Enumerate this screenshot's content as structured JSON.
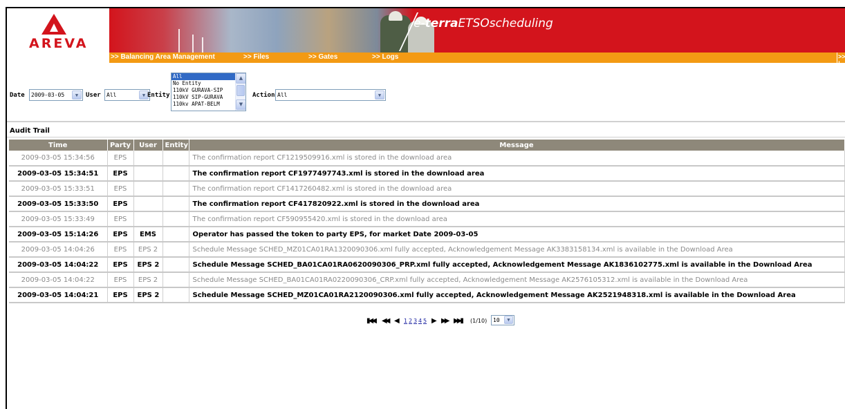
{
  "header": {
    "logo_text": "AREVA",
    "product_prefix": "e-",
    "product_bold": "terra",
    "product_rest": "ETSOscheduling"
  },
  "nav": {
    "items": [
      {
        "label": ">> Balancing Area Management"
      },
      {
        "label": ">> Files"
      },
      {
        "label": ">> Gates"
      },
      {
        "label": ">> Logs"
      }
    ],
    "overflow_label": ">> !"
  },
  "filters": {
    "date_label": "Date",
    "date_value": "2009-03-05",
    "user_label": "User",
    "user_value": "All",
    "entity_label": "Entity",
    "entity_options": [
      "All",
      "No Entity",
      "110kV GURAVA-SIP",
      "110kV SIP-GURAVA",
      "110kv APAT-BELM"
    ],
    "entity_selected": "All",
    "action_label": "Action",
    "action_value": "All"
  },
  "audit": {
    "title": "Audit Trail",
    "columns": [
      "Time",
      "Party",
      "User",
      "Entity",
      "Message"
    ],
    "rows": [
      {
        "time": "2009-03-05 15:34:56",
        "party": "EPS",
        "user": "",
        "entity": "",
        "message": "The confirmation report CF1219509916.xml is stored in the download area",
        "style": "dim"
      },
      {
        "time": "2009-03-05 15:34:51",
        "party": "EPS",
        "user": "",
        "entity": "",
        "message": "The confirmation report CF1977497743.xml is stored in the download area",
        "style": "bold"
      },
      {
        "time": "2009-03-05 15:33:51",
        "party": "EPS",
        "user": "",
        "entity": "",
        "message": "The confirmation report CF1417260482.xml is stored in the download area",
        "style": "dim"
      },
      {
        "time": "2009-03-05 15:33:50",
        "party": "EPS",
        "user": "",
        "entity": "",
        "message": "The confirmation report CF417820922.xml is stored in the download area",
        "style": "bold"
      },
      {
        "time": "2009-03-05 15:33:49",
        "party": "EPS",
        "user": "",
        "entity": "",
        "message": "The confirmation report CF590955420.xml is stored in the download area",
        "style": "dim"
      },
      {
        "time": "2009-03-05 15:14:26",
        "party": "EPS",
        "user": "EMS",
        "entity": "",
        "message": "Operator has passed the token to party EPS, for market Date 2009-03-05",
        "style": "bold"
      },
      {
        "time": "2009-03-05 14:04:26",
        "party": "EPS",
        "user": "EPS 2",
        "entity": "",
        "message": "Schedule Message SCHED_MZ01CA01RA1320090306.xml fully accepted, Acknowledgement Message AK3383158134.xml is available in the Download Area",
        "style": "dim"
      },
      {
        "time": "2009-03-05 14:04:22",
        "party": "EPS",
        "user": "EPS 2",
        "entity": "",
        "message": "Schedule Message SCHED_BA01CA01RA0620090306_PRP.xml fully accepted, Acknowledgement Message AK1836102775.xml is available in the Download Area",
        "style": "bold"
      },
      {
        "time": "2009-03-05 14:04:22",
        "party": "EPS",
        "user": "EPS 2",
        "entity": "",
        "message": "Schedule Message SCHED_BA01CA01RA0220090306_CRP.xml fully accepted, Acknowledgement Message AK2576105312.xml is available in the Download Area",
        "style": "dim"
      },
      {
        "time": "2009-03-05 14:04:21",
        "party": "EPS",
        "user": "EPS 2",
        "entity": "",
        "message": "Schedule Message SCHED_MZ01CA01RA2120090306.xml fully accepted, Acknowledgement Message AK2521948318.xml is available in the Download Area",
        "style": "bold"
      }
    ]
  },
  "pager": {
    "first_icon": "first-page-icon",
    "prev_block_icon": "previous-block-icon",
    "prev_icon": "previous-page-icon",
    "pages": [
      "1",
      "2",
      "3",
      "4",
      "5"
    ],
    "next_icon": "next-page-icon",
    "next_block_icon": "next-block-icon",
    "last_icon": "last-page-icon",
    "status": "(1/10)",
    "page_size": "10"
  }
}
